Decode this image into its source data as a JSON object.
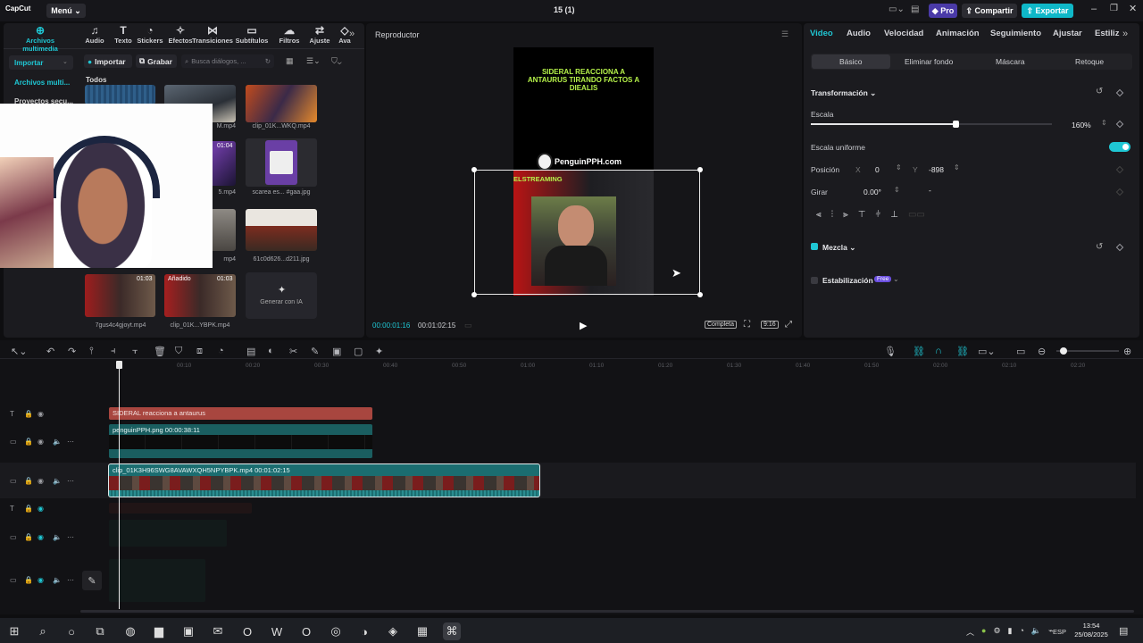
{
  "app": {
    "logo": "CapCut",
    "menu": "Menú",
    "title": "15 (1)",
    "pro": "Pro",
    "share": "Compartir",
    "export": "Exportar"
  },
  "toolbar": [
    {
      "icon": "import-media-icon",
      "label": "Archivos multimedia"
    },
    {
      "icon": "audio-icon",
      "label": "Audio"
    },
    {
      "icon": "text-icon",
      "label": "Texto"
    },
    {
      "icon": "stickers-icon",
      "label": "Stickers"
    },
    {
      "icon": "effects-icon",
      "label": "Efectos"
    },
    {
      "icon": "transitions-icon",
      "label": "Transiciones"
    },
    {
      "icon": "subtitles-icon",
      "label": "Subtítulos"
    },
    {
      "icon": "filters-icon",
      "label": "Filtros"
    },
    {
      "icon": "adjust-icon",
      "label": "Ajuste"
    },
    {
      "icon": "more-icon",
      "label": "Ava"
    }
  ],
  "media": {
    "side": {
      "import": "Importar",
      "files": "Archivos multi...",
      "projects": "Proyectos secu..."
    },
    "import_btn": "Importar",
    "record_btn": "Grabar",
    "search_placeholder": "Busca diálogos, ...",
    "all": "Todos",
    "generate": "Generar con IA",
    "captions": [
      "M.mp4",
      "clip_01K...WKQ.mp4",
      "5.mp4",
      "scarea es... #gaa.jpg",
      "mp4",
      "61c0d626...d211.jpg",
      "mp4",
      "7gus4c4gjoyt.mp4",
      "clip_01K...YBPK.mp4"
    ],
    "durations": [
      "01:04",
      "01:03",
      "01:03"
    ],
    "added": "Añadido"
  },
  "player": {
    "title": "Reproductor",
    "current": "00:00:01:16",
    "total": "00:01:02:15",
    "full": "Completa",
    "ratio": "9:16",
    "overlay_text": "SIDERAL REACCIONA A ANTAURUS TIRANDO FACTOS A DIEALIS",
    "watermark": "PenguinPPH.com",
    "stream_label": "ELSTREAMING"
  },
  "props": {
    "tabs": [
      "Video",
      "Audio",
      "Velocidad",
      "Animación",
      "Seguimiento",
      "Ajustar",
      "Estiliz"
    ],
    "subtabs": [
      "Básico",
      "Eliminar fondo",
      "Máscara",
      "Retoque"
    ],
    "transform": "Transformación",
    "scale": "Escala",
    "scale_value": "160%",
    "scale_level": 0.6,
    "uniform": "Escala uniforme",
    "position": "Posición",
    "x_label": "X",
    "x_value": "0",
    "y_label": "Y",
    "y_value": "-898",
    "rotate": "Girar",
    "rotate_value": "0.00°",
    "rotate_dash": "-",
    "blend": "Mezcla",
    "stabilize": "Estabilización",
    "free": "Free"
  },
  "timeline": {
    "ticks": [
      "00:10",
      "00:20",
      "00:30",
      "00:40",
      "00:50",
      "01:00",
      "01:10",
      "01:20",
      "01:30",
      "01:40",
      "01:50",
      "02:00",
      "02:10",
      "02:20"
    ],
    "text_clip": "SIDERAL reacciona a antaurus",
    "png_clip": "penguinPPH.png  00:00:38:11",
    "main_clip": "clip_01K3H96SWG8AVAWXQH5NPYBPK.mp4  00:01:02:15"
  },
  "taskbar": {
    "lang": "ESP",
    "time": "13:54",
    "date": "25/08/2025"
  },
  "colors": {
    "accent": "#1fc7d4",
    "export": "#0fb8c8",
    "pro": "#7b5cff",
    "text_clip": "#a8463f",
    "main_clip": "#1b6d70"
  }
}
